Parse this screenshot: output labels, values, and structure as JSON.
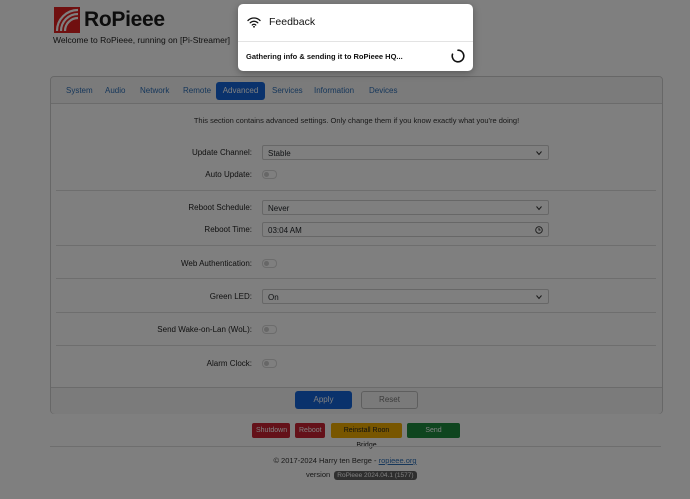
{
  "app": {
    "name": "RoPieee",
    "welcome": "Welcome to RoPieee, running on [Pi-Streamer]"
  },
  "tabs": [
    {
      "label": "System"
    },
    {
      "label": "Audio"
    },
    {
      "label": "Network"
    },
    {
      "label": "Remote"
    },
    {
      "label": "Advanced",
      "active": true
    },
    {
      "label": "Services"
    },
    {
      "label": "Information"
    },
    {
      "label": "Devices"
    }
  ],
  "advanced": {
    "info": "This section contains advanced settings. Only change them if you know exactly what you're doing!",
    "update_channel_label": "Update Channel:",
    "update_channel_value": "Stable",
    "auto_update_label": "Auto Update:",
    "reboot_schedule_label": "Reboot Schedule:",
    "reboot_schedule_value": "Never",
    "reboot_time_label": "Reboot Time:",
    "reboot_time_value": "03:04 AM",
    "web_auth_label": "Web Authentication:",
    "green_led_label": "Green LED:",
    "green_led_value": "On",
    "wol_label": "Send Wake-on-Lan (WoL):",
    "alarm_clock_label": "Alarm Clock:"
  },
  "buttons": {
    "apply": "Apply",
    "reset": "Reset"
  },
  "actions": {
    "shutdown": "Shutdown",
    "reboot": "Reboot",
    "reinstall": "Reinstall Roon Bridge",
    "feedback": "Send Feedback"
  },
  "footer": {
    "copyright": "© 2017-2024 Harry ten Berge - ",
    "link": "ropieee.org",
    "version_label": "version",
    "version_value": "RoPieee 2024.04.1 (1577)"
  },
  "modal": {
    "title": "Feedback",
    "message": "Gathering info & sending it to RoPieee HQ..."
  },
  "colors": {
    "primary": "#1565d8",
    "danger": "#c82333",
    "warning": "#f0ad00",
    "success": "#1e8a3e"
  }
}
